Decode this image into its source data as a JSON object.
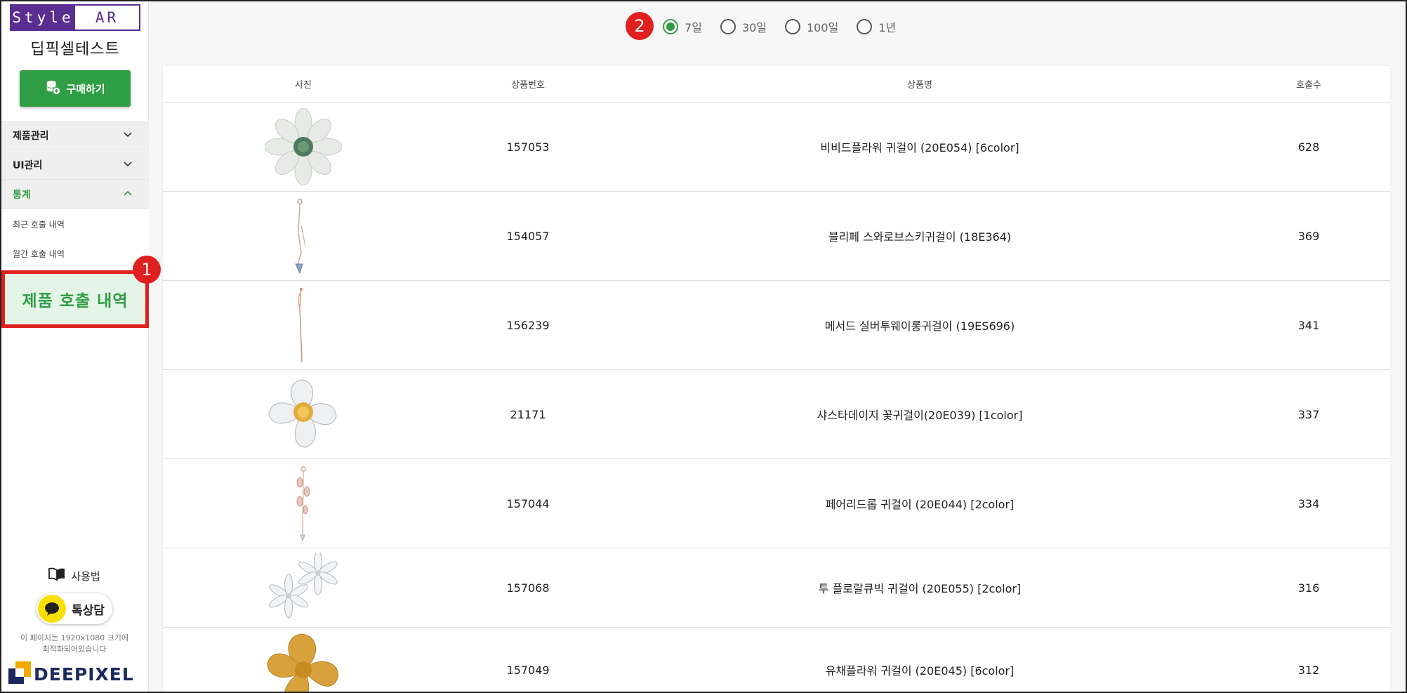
{
  "sidebar": {
    "logo_left": "Style",
    "logo_right": "AR",
    "brand_name": "딥픽셀테스트",
    "buy_button": "구매하기",
    "menu": [
      {
        "label": "제품관리",
        "state": "collapsed"
      },
      {
        "label": "UI관리",
        "state": "collapsed"
      },
      {
        "label": "통계",
        "state": "expanded"
      }
    ],
    "sub_items": [
      "최근 호출 내역",
      "월간 호출 내역"
    ],
    "highlighted_item": "제품 호출 내역",
    "usage_label": "사용법",
    "kakao_label": "톡상담",
    "notice_line1": "이 페이지는 1920x1080 크기에",
    "notice_line2": "최적화되어있습니다",
    "company_logo": "DEEPIXEL"
  },
  "annotations": {
    "badge_1": "1",
    "badge_2": "2"
  },
  "period_filter": {
    "options": [
      "7일",
      "30일",
      "100일",
      "1년"
    ],
    "selected": "7일"
  },
  "table": {
    "headers": {
      "photo": "사진",
      "number": "상품번호",
      "name": "상품명",
      "count": "호출수"
    },
    "rows": [
      {
        "number": "157053",
        "name": "비비드플라워 귀걸이 (20E054) [6color]",
        "count": "628",
        "photo": "white-flower-earring"
      },
      {
        "number": "154057",
        "name": "블리페 스와로브스키귀걸이 (18E364)",
        "count": "369",
        "photo": "drop-earring"
      },
      {
        "number": "156239",
        "name": "메서드 실버투웨이롱귀걸이 (19ES696)",
        "count": "341",
        "photo": "long-chain-earring"
      },
      {
        "number": "21171",
        "name": "샤스타데이지 꽃귀걸이(20E039) [1color]",
        "count": "337",
        "photo": "daisy-earring"
      },
      {
        "number": "157044",
        "name": "페어리드롭 귀걸이 (20E044) [2color]",
        "count": "334",
        "photo": "fairy-drop-earring"
      },
      {
        "number": "157068",
        "name": "투 플로랄큐빅 귀걸이 (20E055) [2color]",
        "count": "316",
        "photo": "floral-cubic-earring"
      },
      {
        "number": "157049",
        "name": "유채플라워 귀걸이 (20E045) [6color]",
        "count": "312",
        "photo": "yellow-flower-earring"
      }
    ]
  },
  "colors": {
    "accent_green": "#2f9e44",
    "brand_purple": "#5a2d91",
    "annotation_red": "#e0201e"
  }
}
